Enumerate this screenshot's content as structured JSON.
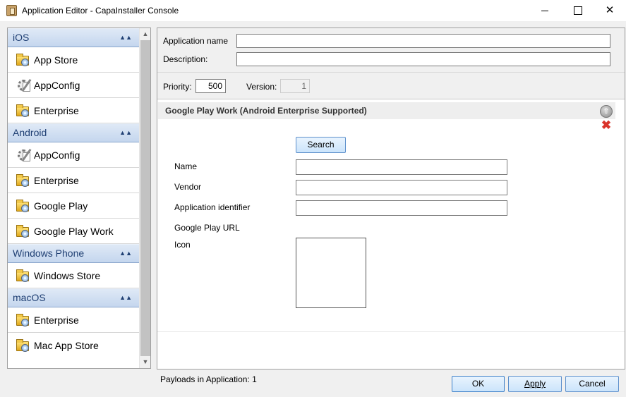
{
  "window": {
    "title": "Application Editor - CapaInstaller Console",
    "app_icon": "capainstaller-icon"
  },
  "nav": {
    "groups": [
      {
        "label": "iOS",
        "items": [
          {
            "label": "App Store",
            "icon": "folder-disc-icon"
          },
          {
            "label": "AppConfig",
            "icon": "gear-icon"
          },
          {
            "label": "Enterprise",
            "icon": "folder-disc-icon"
          }
        ]
      },
      {
        "label": "Android",
        "items": [
          {
            "label": "AppConfig",
            "icon": "gear-icon"
          },
          {
            "label": "Enterprise",
            "icon": "folder-disc-icon"
          },
          {
            "label": "Google Play",
            "icon": "folder-disc-icon"
          },
          {
            "label": "Google Play Work",
            "icon": "folder-disc-icon"
          }
        ]
      },
      {
        "label": "Windows Phone",
        "items": [
          {
            "label": "Windows Store",
            "icon": "folder-disc-icon"
          }
        ]
      },
      {
        "label": "macOS",
        "items": [
          {
            "label": "Enterprise",
            "icon": "folder-disc-icon"
          },
          {
            "label": "Mac App Store",
            "icon": "folder-disc-icon"
          }
        ]
      }
    ]
  },
  "form": {
    "app_name_label": "Application name",
    "app_name_value": "",
    "description_label": "Description:",
    "description_value": "",
    "priority_label": "Priority:",
    "priority_value": "500",
    "version_label": "Version:",
    "version_value": "1"
  },
  "payload": {
    "header": "Google Play Work (Android Enterprise Supported)",
    "search_label": "Search",
    "name_label": "Name",
    "name_value": "",
    "vendor_label": "Vendor",
    "vendor_value": "",
    "appid_label": "Application identifier",
    "appid_value": "",
    "url_label": "Google Play URL",
    "icon_label": "Icon"
  },
  "footer": {
    "status": "Payloads in Application: 1",
    "ok_label": "OK",
    "apply_label": "Apply",
    "cancel_label": "Cancel"
  }
}
